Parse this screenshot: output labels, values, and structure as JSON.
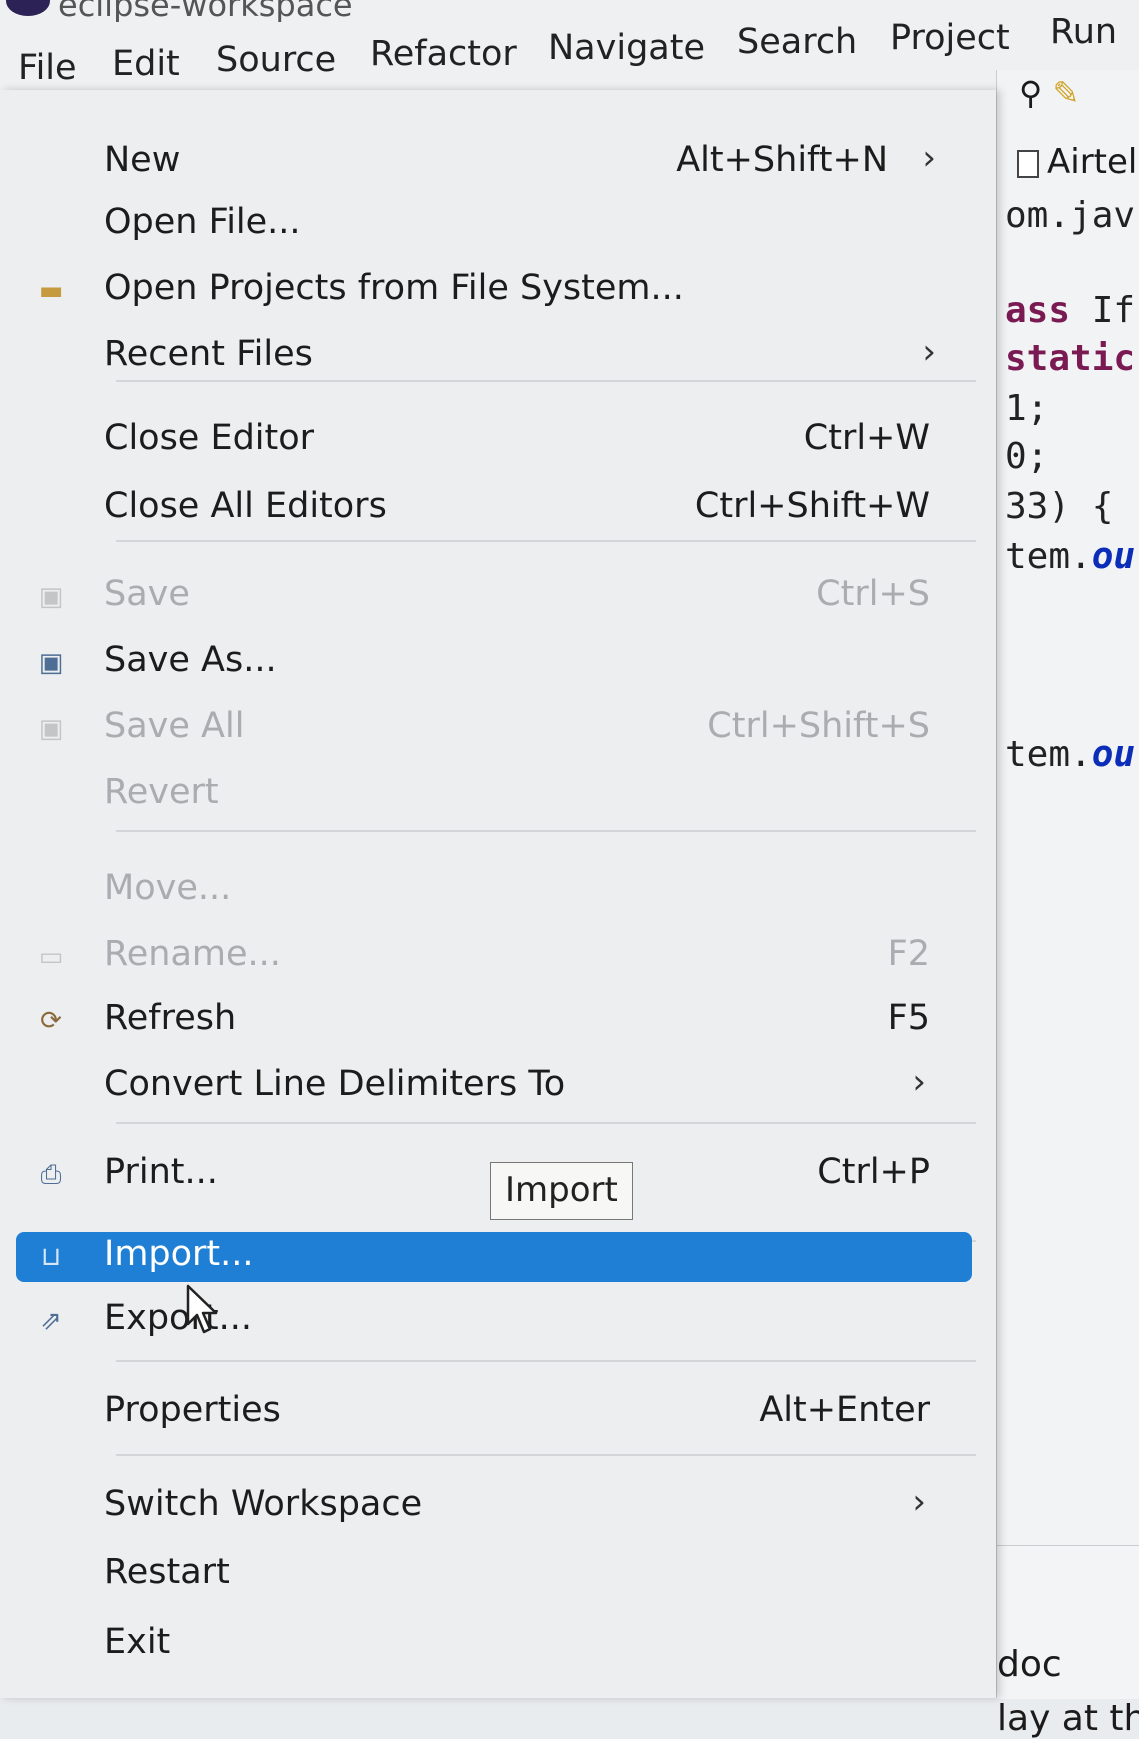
{
  "window": {
    "title": "eclipse-workspace"
  },
  "menubar": {
    "items": [
      "File",
      "Edit",
      "Source",
      "Refactor",
      "Navigate",
      "Search",
      "Project",
      "Run"
    ]
  },
  "file_menu": {
    "items": [
      {
        "label": "New",
        "shortcut": "Alt+Shift+N",
        "submenu": true,
        "enabled": true,
        "icon": ""
      },
      {
        "label": "Open File...",
        "shortcut": "",
        "submenu": false,
        "enabled": true,
        "icon": ""
      },
      {
        "label": "Open Projects from File System...",
        "shortcut": "",
        "submenu": false,
        "enabled": true,
        "icon": "folder-icon"
      },
      {
        "label": "Recent Files",
        "shortcut": "",
        "submenu": true,
        "enabled": true,
        "icon": ""
      },
      {
        "label": "Close Editor",
        "shortcut": "Ctrl+W",
        "submenu": false,
        "enabled": true,
        "icon": ""
      },
      {
        "label": "Close All Editors",
        "shortcut": "Ctrl+Shift+W",
        "submenu": false,
        "enabled": true,
        "icon": ""
      },
      {
        "label": "Save",
        "shortcut": "Ctrl+S",
        "submenu": false,
        "enabled": false,
        "icon": "save-icon"
      },
      {
        "label": "Save As...",
        "shortcut": "",
        "submenu": false,
        "enabled": true,
        "icon": "save-as-icon"
      },
      {
        "label": "Save All",
        "shortcut": "Ctrl+Shift+S",
        "submenu": false,
        "enabled": false,
        "icon": "save-all-icon"
      },
      {
        "label": "Revert",
        "shortcut": "",
        "submenu": false,
        "enabled": false,
        "icon": ""
      },
      {
        "label": "Move...",
        "shortcut": "",
        "submenu": false,
        "enabled": false,
        "icon": ""
      },
      {
        "label": "Rename...",
        "shortcut": "F2",
        "submenu": false,
        "enabled": false,
        "icon": "rename-icon"
      },
      {
        "label": "Refresh",
        "shortcut": "F5",
        "submenu": false,
        "enabled": true,
        "icon": "refresh-icon"
      },
      {
        "label": "Convert Line Delimiters To",
        "shortcut": "",
        "submenu": true,
        "enabled": true,
        "icon": ""
      },
      {
        "label": "Print...",
        "shortcut": "Ctrl+P",
        "submenu": false,
        "enabled": true,
        "icon": "print-icon"
      },
      {
        "label": "Import...",
        "shortcut": "",
        "submenu": false,
        "enabled": true,
        "icon": "import-icon",
        "selected": true
      },
      {
        "label": "Export...",
        "shortcut": "",
        "submenu": false,
        "enabled": true,
        "icon": "export-icon"
      },
      {
        "label": "Properties",
        "shortcut": "Alt+Enter",
        "submenu": false,
        "enabled": true,
        "icon": ""
      },
      {
        "label": "Switch Workspace",
        "shortcut": "",
        "submenu": true,
        "enabled": true,
        "icon": ""
      },
      {
        "label": "Restart",
        "shortcut": "",
        "submenu": false,
        "enabled": true,
        "icon": ""
      },
      {
        "label": "Exit",
        "shortcut": "",
        "submenu": false,
        "enabled": true,
        "icon": ""
      }
    ],
    "tooltip": "Import"
  },
  "editor": {
    "tab_label": "Airtel",
    "code_lines": [
      {
        "pre": "om.jav",
        "kw": "",
        "fld": ""
      },
      {
        "pre": "",
        "kw": "ass",
        "fld": "",
        "post": " If"
      },
      {
        "pre": "",
        "kw": "static",
        "fld": ""
      },
      {
        "pre": "1;",
        "kw": "",
        "fld": ""
      },
      {
        "pre": "0;",
        "kw": "",
        "fld": ""
      },
      {
        "pre": "33) {",
        "kw": "",
        "fld": ""
      },
      {
        "pre": "tem.",
        "kw": "",
        "fld": "ou"
      },
      {
        "pre": "tem.",
        "kw": "",
        "fld": "ou"
      }
    ],
    "bottom": {
      "line1": "doc",
      "line2": "lay at thi"
    }
  },
  "colors": {
    "selection": "#1f7fd4",
    "menu_bg": "#eceeef",
    "disabled_text": "#a9adb0"
  }
}
